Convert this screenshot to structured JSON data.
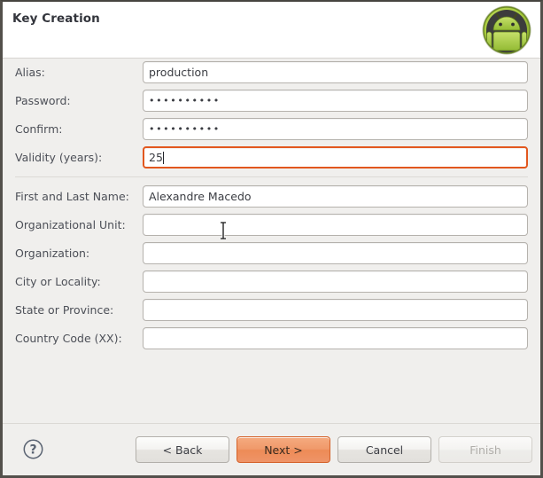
{
  "window": {
    "title": "Key Creation",
    "logo_icon": "android-robot-icon"
  },
  "form": {
    "key_fields": [
      {
        "label": "Alias:",
        "value": "production",
        "type": "text",
        "focused": false
      },
      {
        "label": "Password:",
        "value": "••••••••••",
        "type": "password",
        "focused": false
      },
      {
        "label": "Confirm:",
        "value": "••••••••••",
        "type": "password",
        "focused": false
      },
      {
        "label": "Validity (years):",
        "value": "25",
        "type": "text",
        "focused": true
      }
    ],
    "identity_fields": [
      {
        "label": "First and Last Name:",
        "value": "Alexandre Macedo",
        "type": "text",
        "focused": false
      },
      {
        "label": "Organizational Unit:",
        "value": "",
        "type": "text",
        "focused": false
      },
      {
        "label": "Organization:",
        "value": "",
        "type": "text",
        "focused": false
      },
      {
        "label": "City or Locality:",
        "value": "",
        "type": "text",
        "focused": false
      },
      {
        "label": "State or Province:",
        "value": "",
        "type": "text",
        "focused": false
      },
      {
        "label": "Country Code (XX):",
        "value": "",
        "type": "text",
        "focused": false
      }
    ]
  },
  "buttonbar": {
    "help_icon": "question-mark-circle-icon",
    "buttons": [
      {
        "label": "< Back",
        "state": "enabled",
        "primary": false
      },
      {
        "label": "Next >",
        "state": "enabled",
        "primary": true
      },
      {
        "label": "Cancel",
        "state": "enabled",
        "primary": false
      },
      {
        "label": "Finish",
        "state": "disabled",
        "primary": false
      }
    ]
  },
  "colors": {
    "focus_border": "#e2571e",
    "primary_button": "#ed8b56",
    "background": "#f0efed",
    "header_background": "#ffffff",
    "title_text": "#33353c",
    "label_text": "#4c4f57",
    "android_green": "#a4c639"
  }
}
